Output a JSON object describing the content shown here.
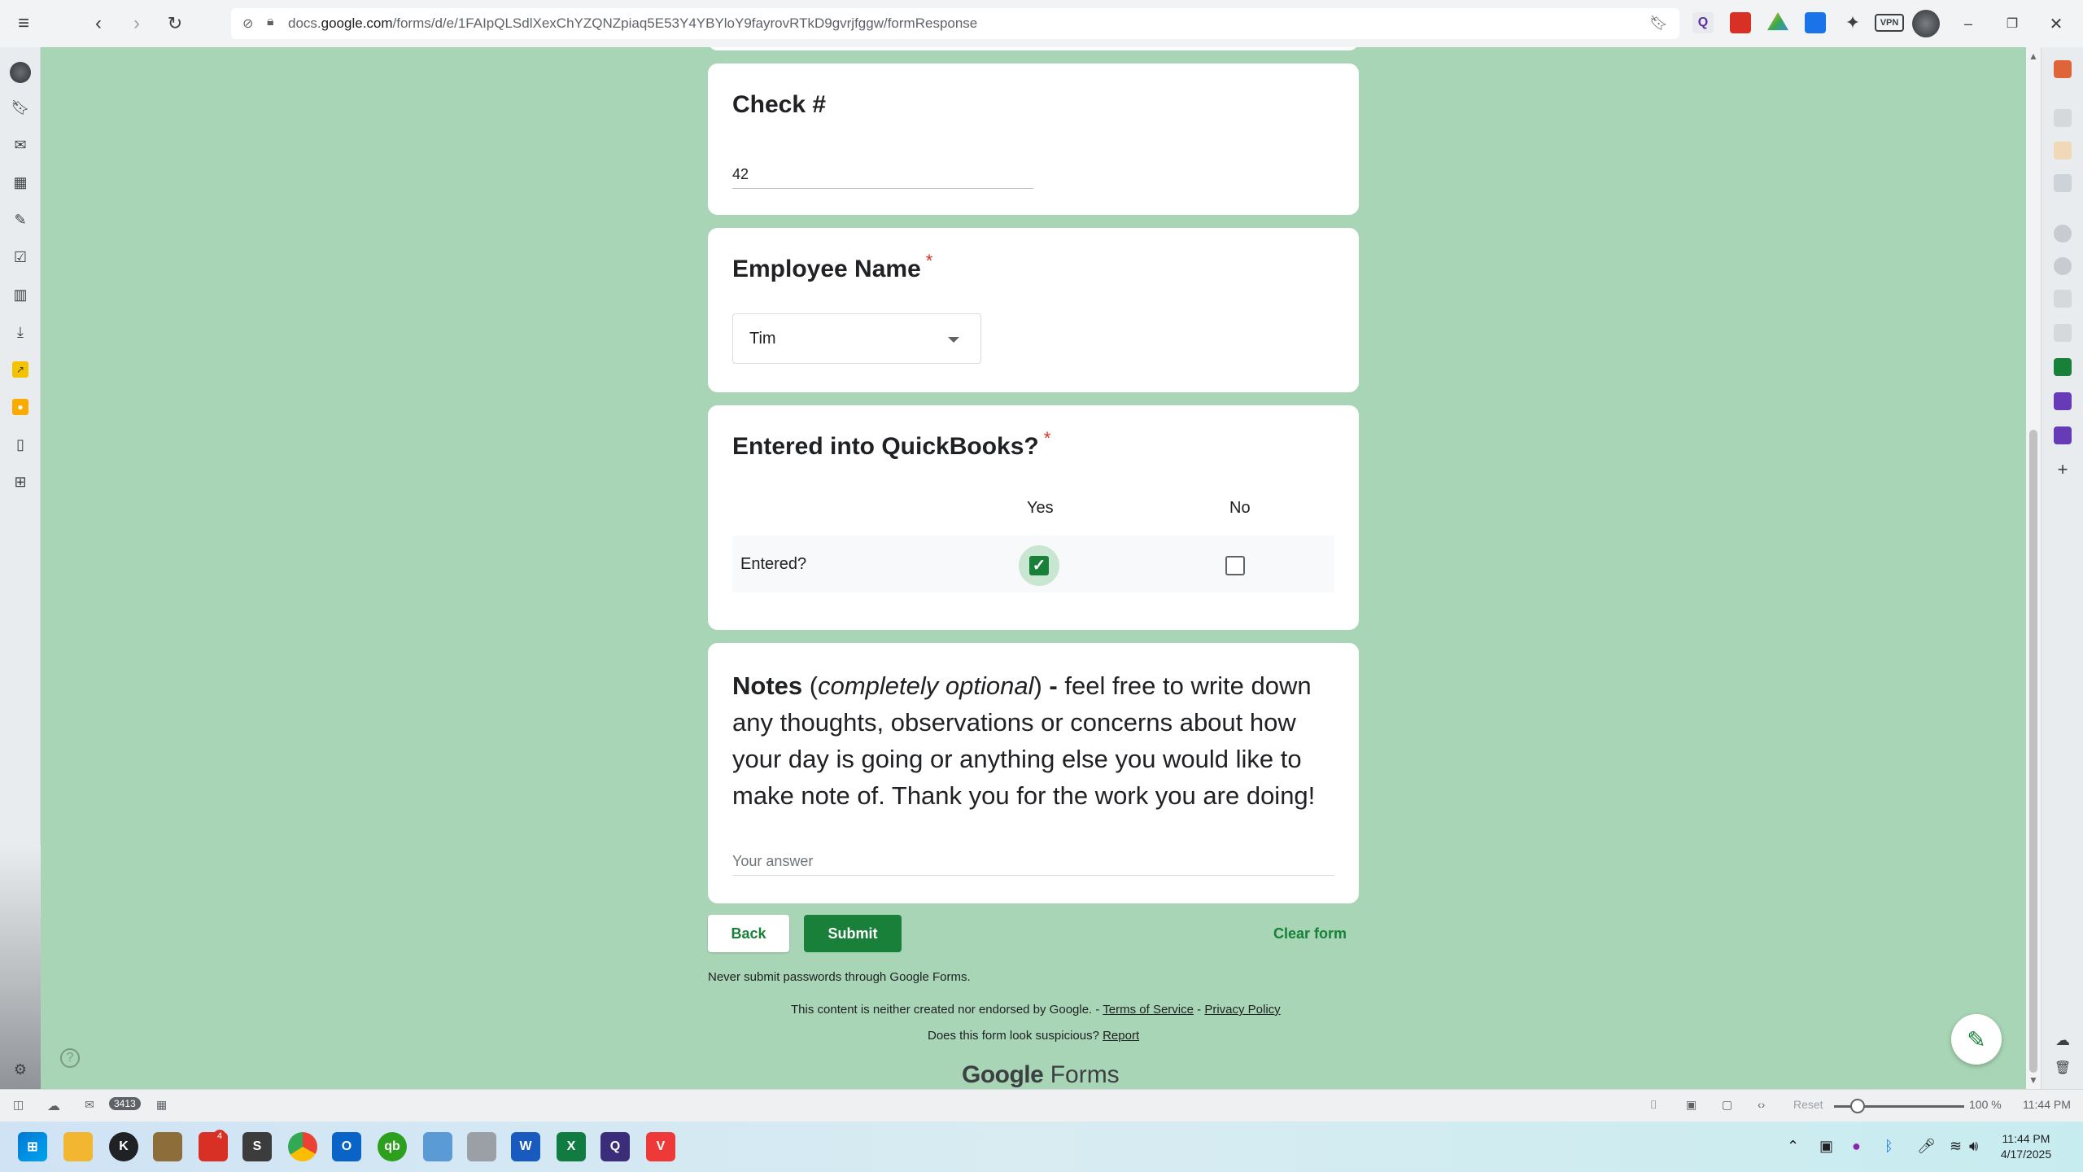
{
  "browser": {
    "url_prefix": "docs.",
    "url_domain": "google.com",
    "url_path": "/forms/d/e/1FAIpQLSdlXexChYZQNZpiaq5E53Y4YBYloY9fayrovRTkD9gvrjfggw/formResponse",
    "vpn_label": "VPN"
  },
  "form": {
    "check_number": {
      "title": "Check #",
      "value": "42"
    },
    "employee_name": {
      "title": "Employee Name",
      "required_mark": "*",
      "selected": "Tim"
    },
    "quickbooks": {
      "title": "Entered into QuickBooks?",
      "required_mark": "*",
      "columns": [
        "Yes",
        "No"
      ],
      "row_label": "Entered?",
      "selected_column": "Yes"
    },
    "notes": {
      "title_bold": "Notes",
      "open_paren": " (",
      "title_italic": "completely optional",
      "close_paren": ")",
      "dash": " - ",
      "prompt": "feel free to write down any thoughts, observations or concerns about how your day is going or anything else you would like to make note of. Thank you for the work you are doing!",
      "placeholder": "Your answer"
    },
    "buttons": {
      "back": "Back",
      "submit": "Submit",
      "clear": "Clear form"
    },
    "footer": {
      "warning": "Never submit passwords through Google Forms.",
      "disclaimer": "This content is neither created nor endorsed by Google. - ",
      "terms": "Terms of Service",
      "separator": " - ",
      "privacy": "Privacy Policy",
      "suspicious": "Does this form look suspicious? ",
      "report": "Report",
      "brand_google": "Google",
      "brand_forms": "Forms"
    }
  },
  "statusbar": {
    "mail_count": "3413",
    "reset_label": "Reset",
    "zoom": "100 %",
    "time": "11:44 PM"
  },
  "taskbar": {
    "clock_time": "11:44 PM",
    "clock_date": "4/17/2025",
    "badge_count": "4"
  },
  "colors": {
    "page_bg": "#a8d5b5",
    "accent": "#188038",
    "required": "#d93025"
  }
}
